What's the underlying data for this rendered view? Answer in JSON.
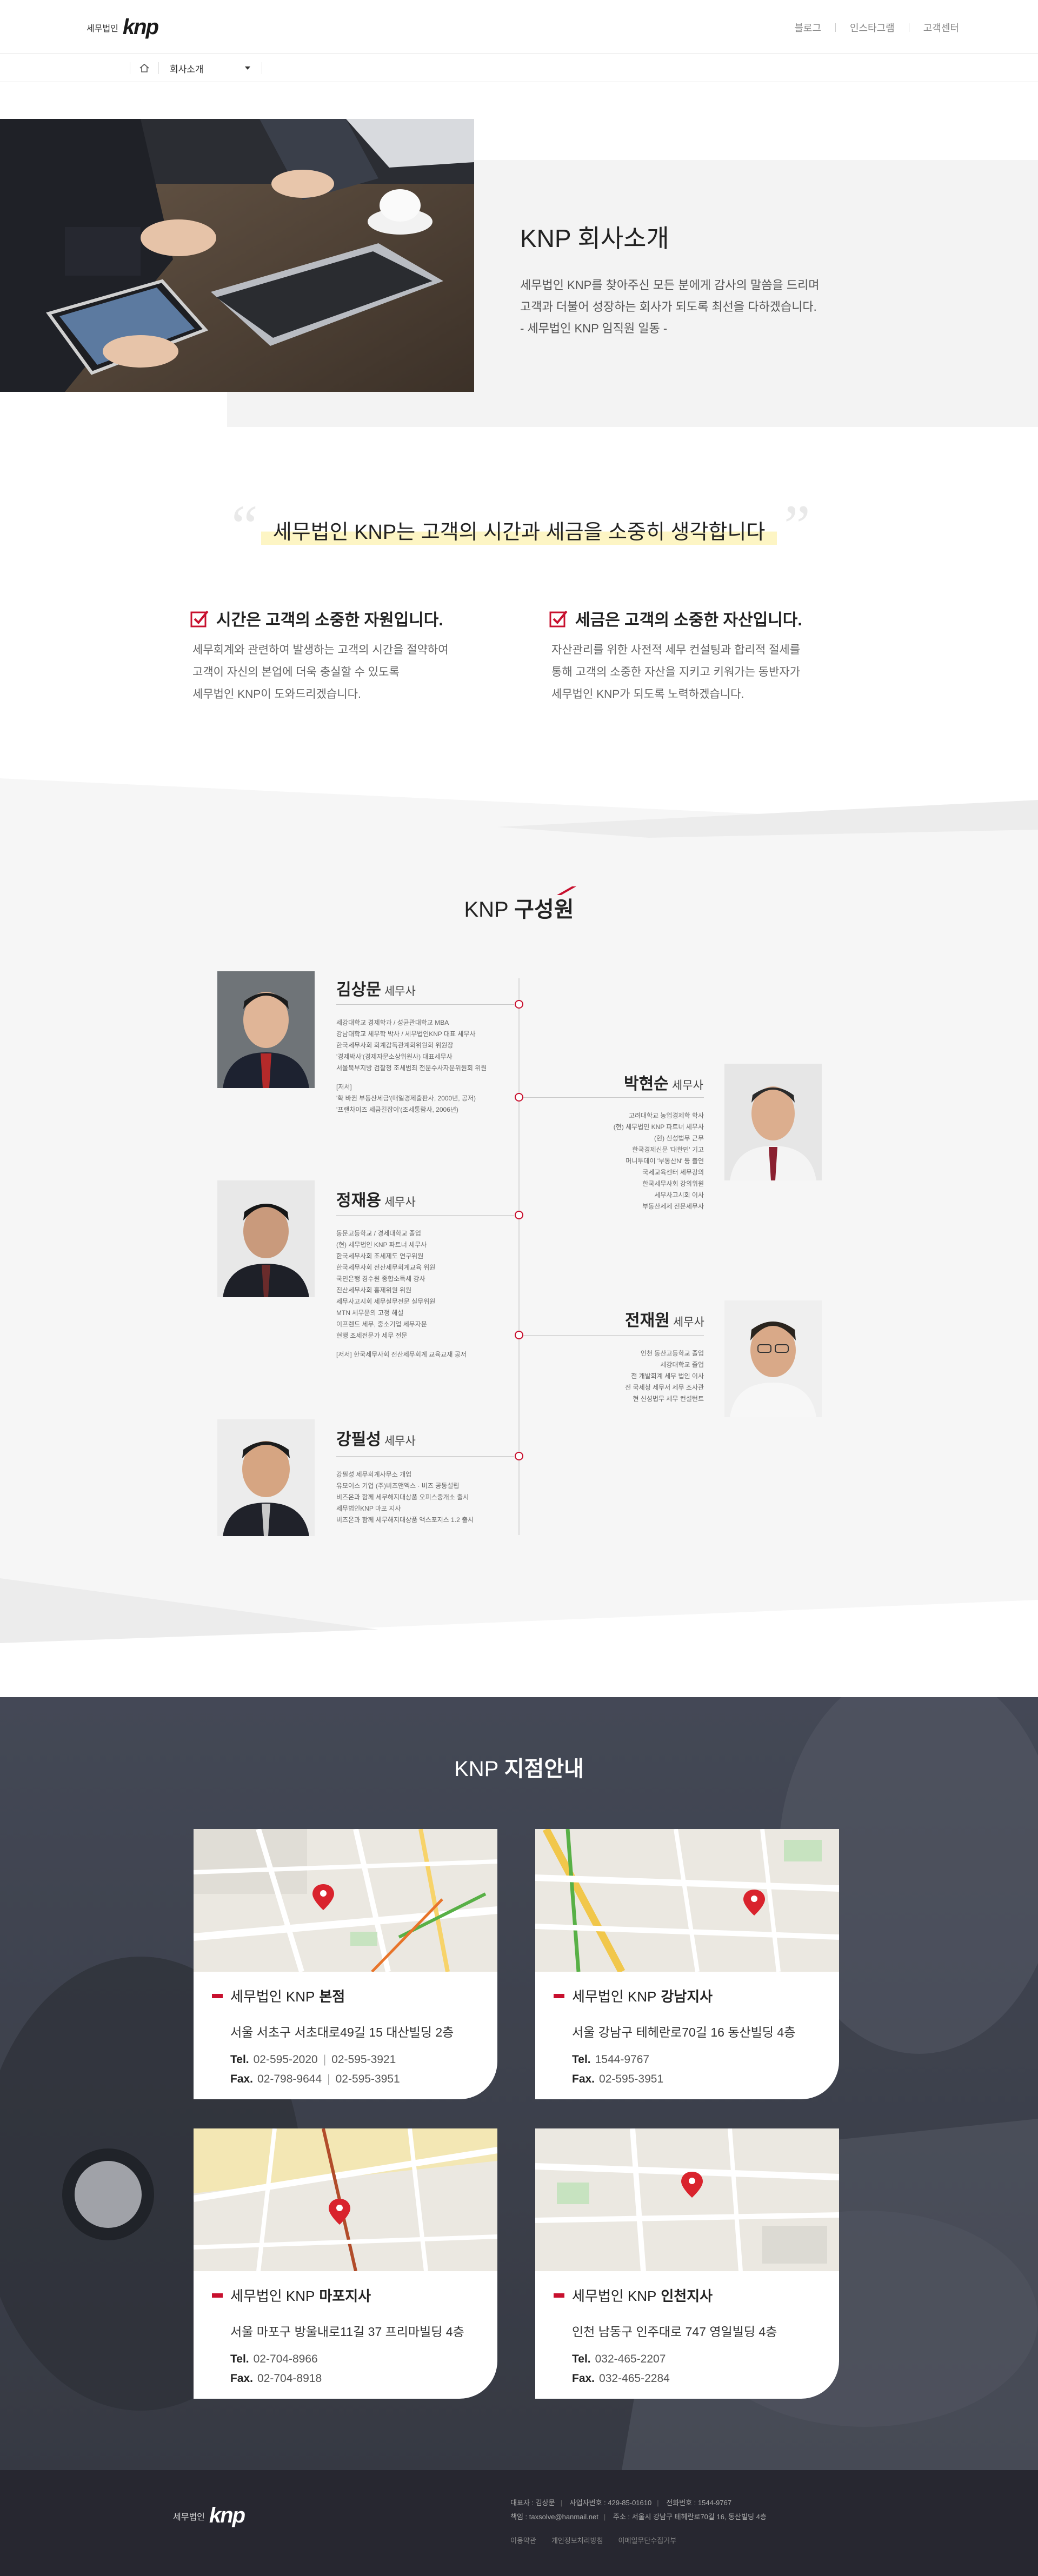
{
  "header": {
    "logo_small": "세무법인",
    "logo_big": "knp",
    "nav": [
      "블로그",
      "인스타그램",
      "고객센터"
    ]
  },
  "breadcrumb": {
    "current": "회사소개"
  },
  "intro": {
    "title": "KNP 회사소개",
    "lines": [
      "세무법인 KNP를 찾아주신 모든 분에게 감사의 말씀을 드리며",
      "고객과 더불어 성장하는 회사가 되도록 최선을 다하겠습니다.",
      "- 세무법인 KNP 임직원 일동 -"
    ]
  },
  "slogan": "세무법인 KNP는 고객의 시간과 세금을 소중히 생각합니다",
  "features": [
    {
      "title": "시간은 고객의 소중한 자원입니다.",
      "lines": [
        "세무회계와 관련하여 발생하는 고객의 시간을 절약하여",
        "고객이 자신의 본업에 더욱 충실할 수 있도록",
        "세무법인 KNP이 도와드리겠습니다."
      ]
    },
    {
      "title": "세금은 고객의 소중한 자산입니다.",
      "lines": [
        "자산관리를 위한 사전적 세무 컨설팅과 합리적 절세를",
        "통해 고객의 소중한 자산을 지키고 키워가는 동반자가",
        "세무법인 KNP가 되도록 노력하겠습니다."
      ]
    }
  ],
  "members": {
    "title_normal": "KNP",
    "title_bold": "구성원",
    "list": [
      {
        "name": "김상문",
        "role": "세무사",
        "lines": [
          "세강대학교 경제학과 / 성균관대학교 MBA",
          "강남대학교 세무학 박사 / 세무법인KNP 대표 세무사",
          "한국세무사회 회계감독관계회위원회 위원장",
          "'경제박사'(경제자문소상위원사) 대표세무사",
          "서울북부지방 검찰청 조세범죄 전문수사자문위원회 위원",
          "",
          "[저서]",
          "'확 바뀐 부동산세금'(매일경제출판사, 2000년, 공저)",
          "'프랜차이즈 세금길잡이'(조세통람사, 2006년)"
        ]
      },
      {
        "name": "박현순",
        "role": "세무사",
        "lines": [
          "고려대학교 농업경제학 학사",
          "(현) 세무법인 KNP 파트너 세무사",
          "(현) 신성법무 근무",
          "한국경제신문 '대한민' 기고",
          "머니투데이 '부동산N' 등 출연",
          "국세교육센터 세무강의",
          "한국세무사회 강의위원",
          "세무사고시회 이사",
          "부동산세제 전문세무사"
        ]
      },
      {
        "name": "정재용",
        "role": "세무사",
        "lines": [
          "동문고등학교 / 경제대학교 졸업",
          "(현) 세무법인 KNP 파트너 세무사",
          "한국세무사회 조세제도 연구위원",
          "한국세무사회 전산세무회계교육 위원",
          "국민은행 경수원 종합소득세 강사",
          "진산세무사회 홍제위원 위원",
          "세무사고시회 세무실무전문 실무위원",
          "MTN 세무문의 고정 해설",
          "이프렌드 세무, 중소기업 세무자문",
          "현행 조세전문가 세무 전문",
          "",
          "[저서] 한국세무사회 전산세무회계 교육교재 공저"
        ]
      },
      {
        "name": "전재원",
        "role": "세무사",
        "lines": [
          "인천 동산고등학교 졸업",
          "세강대학교 졸업",
          "전 개발회계 세무 법인 이사",
          "전 국세청 세무서 세무 조사관",
          "현 신성법무 세무 컨설턴트"
        ]
      },
      {
        "name": "강필성",
        "role": "세무사",
        "lines": [
          "강필성 세무회계사무소 개업",
          "유모어스 기업 (주)비즈앤엑스 · 비즈 공동설립",
          "비즈온과 함께 세무해지대상품 오피스중개소 출시",
          "세무법인KNP 마포 지사",
          "비즈온과 함께 세무해지대상품 액스포지스 1.2 출시"
        ]
      }
    ]
  },
  "branches": {
    "title_normal": "KNP",
    "title_bold": "지점안내",
    "list": [
      {
        "prefix": "세무법인 KNP",
        "name": "본점",
        "address": "서울 서초구 서초대로49길 15 대산빌딩 2층",
        "tel": [
          "02-595-2020",
          "02-595-3921"
        ],
        "fax": [
          "02-798-9644",
          "02-595-3951"
        ],
        "tel_label": "Tel.",
        "fax_label": "Fax."
      },
      {
        "prefix": "세무법인 KNP",
        "name": "강남지사",
        "address": "서울 강남구 테헤란로70길 16 동산빌딩 4층",
        "tel": [
          "1544-9767"
        ],
        "fax": [
          "02-595-3951"
        ],
        "tel_label": "Tel.",
        "fax_label": "Fax."
      },
      {
        "prefix": "세무법인 KNP",
        "name": "마포지사",
        "address": "서울 마포구 방울내로11길 37 프리마빌딩 4층",
        "tel": [
          "02-704-8966"
        ],
        "fax": [
          "02-704-8918"
        ],
        "tel_label": "Tel.",
        "fax_label": "Fax."
      },
      {
        "prefix": "세무법인 KNP",
        "name": "인천지사",
        "address": "인천 남동구 인주대로 747 영일빌딩 4층",
        "tel": [
          "032-465-2207"
        ],
        "fax": [
          "032-465-2284"
        ],
        "tel_label": "Tel.",
        "fax_label": "Fax."
      }
    ]
  },
  "footer": {
    "logo_small": "세무법인",
    "logo_big": "knp",
    "line1": [
      "대표자 : 김상문",
      "사업자번호 : 429-85-01610",
      "전화번호 : 1544-9767"
    ],
    "line2": [
      "책임 : taxsolve@hanmail.net",
      "주소 : 서울시 강남구 테헤란로70길 16, 동산빌딩 4층"
    ],
    "links": [
      "이용약관",
      "개인정보처리방침",
      "이메일무단수집거부"
    ]
  },
  "colors": {
    "brand": "#c8102e",
    "footer_bg": "#272730",
    "highlight": "#fdf5c4"
  }
}
